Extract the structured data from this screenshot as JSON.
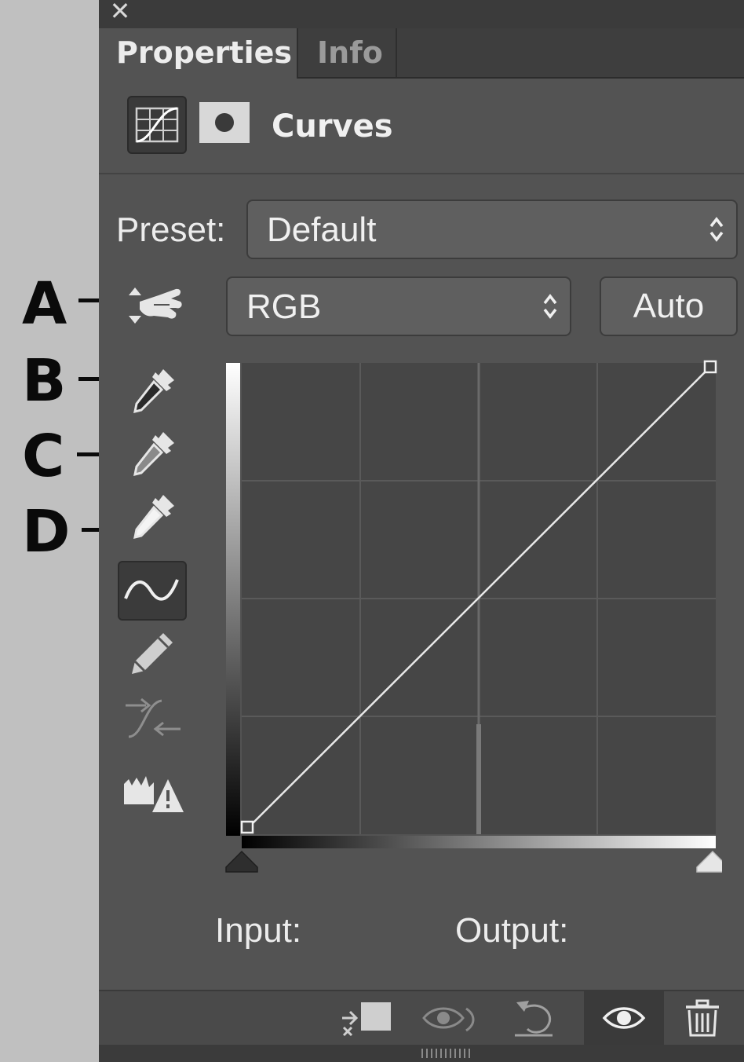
{
  "window": {
    "close_glyph": "✕"
  },
  "tabs": [
    {
      "label": "Properties",
      "active": true
    },
    {
      "label": "Info",
      "active": false
    }
  ],
  "header": {
    "title": "Curves",
    "adjustment_icon": "curves-adjustment-icon",
    "mask_icon": "layer-mask-icon"
  },
  "preset": {
    "label": "Preset:",
    "value": "Default"
  },
  "channel": {
    "value": "RGB"
  },
  "auto_label": "Auto",
  "callouts": [
    "A",
    "B",
    "C",
    "D"
  ],
  "tools": [
    "on-image-adjust-icon",
    "sample-black-point-eyedropper-icon",
    "sample-gray-point-eyedropper-icon",
    "sample-white-point-eyedropper-icon",
    "edit-points-curve-icon",
    "draw-pencil-icon",
    "smooth-curve-icon",
    "clipping-warning-icon"
  ],
  "io": {
    "input_label": "Input:",
    "output_label": "Output:"
  },
  "bottom_bar": [
    "clip-to-layer-icon",
    "view-previous-state-icon",
    "reset-icon",
    "toggle-visibility-icon",
    "delete-icon"
  ],
  "colors": {
    "panel": "#535353",
    "titlebar": "#3b3b3b",
    "text": "#ececec"
  }
}
